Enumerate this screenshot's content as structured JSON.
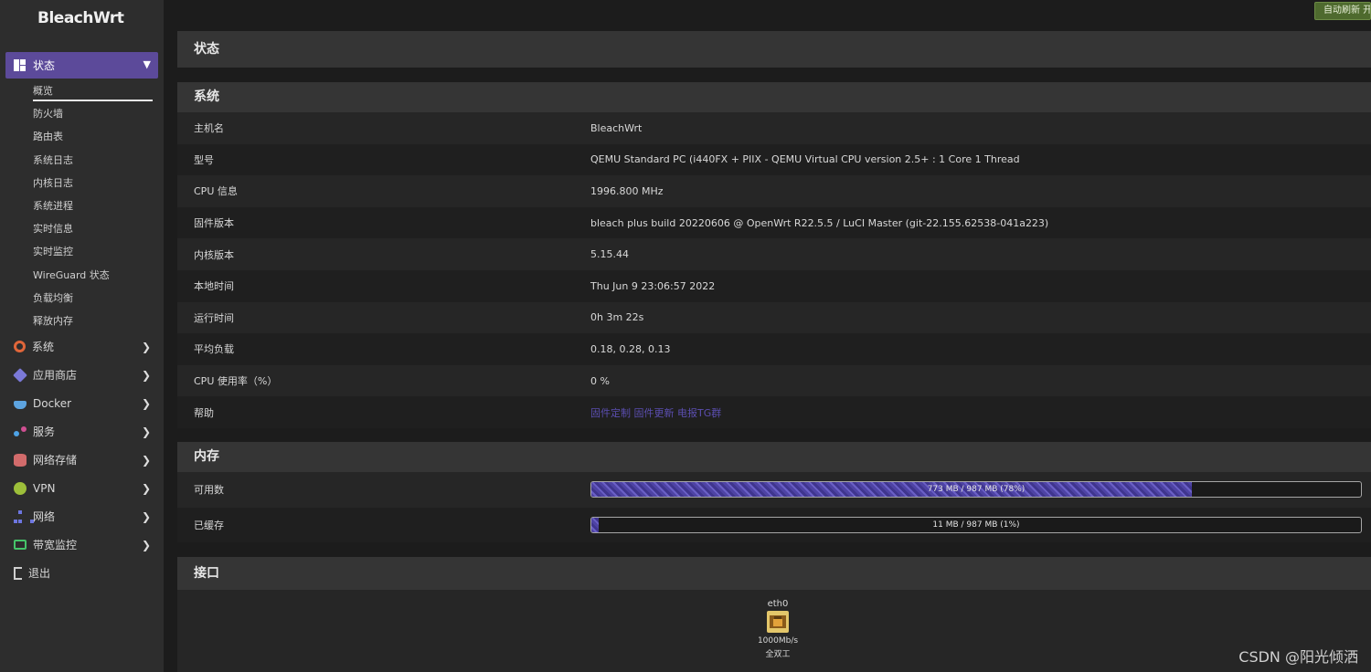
{
  "brand": "BleachWrt",
  "auto_refresh_label": "自动刷新 开",
  "sidebar": {
    "active_menu": "状态",
    "submenu": [
      "概览",
      "防火墙",
      "路由表",
      "系统日志",
      "内核日志",
      "系统进程",
      "实时信息",
      "实时监控",
      "WireGuard 状态",
      "负载均衡",
      "释放内存"
    ],
    "menu": [
      {
        "label": "系统",
        "icon": "gear-icon",
        "has_arrow": true
      },
      {
        "label": "应用商店",
        "icon": "cube-icon",
        "has_arrow": true
      },
      {
        "label": "Docker",
        "icon": "docker-icon",
        "has_arrow": true
      },
      {
        "label": "服务",
        "icon": "services-icon",
        "has_arrow": true
      },
      {
        "label": "网络存储",
        "icon": "database-icon",
        "has_arrow": true
      },
      {
        "label": "VPN",
        "icon": "globe-icon",
        "has_arrow": true
      },
      {
        "label": "网络",
        "icon": "network-tree-icon",
        "has_arrow": true
      },
      {
        "label": "带宽监控",
        "icon": "monitor-icon",
        "has_arrow": true
      },
      {
        "label": "退出",
        "icon": "logout-icon",
        "has_arrow": false
      }
    ]
  },
  "page_title": "状态",
  "system": {
    "title": "系统",
    "rows": [
      {
        "key": "主机名",
        "value": "BleachWrt"
      },
      {
        "key": "型号",
        "value": "QEMU Standard PC (i440FX + PIIX - QEMU Virtual CPU version 2.5+ : 1 Core 1 Thread"
      },
      {
        "key": "CPU 信息",
        "value": "1996.800 MHz"
      },
      {
        "key": "固件版本",
        "value": "bleach plus build 20220606 @ OpenWrt R22.5.5 / LuCI Master (git-22.155.62538-041a223)"
      },
      {
        "key": "内核版本",
        "value": "5.15.44"
      },
      {
        "key": "本地时间",
        "value": "Thu Jun 9 23:06:57 2022"
      },
      {
        "key": "运行时间",
        "value": "0h 3m 22s"
      },
      {
        "key": "平均负载",
        "value": "0.18, 0.28, 0.13"
      },
      {
        "key": "CPU 使用率（%）",
        "value": "0 %"
      },
      {
        "key": "帮助",
        "value": "固件定制 固件更新 电报TG群"
      }
    ]
  },
  "memory": {
    "title": "内存",
    "rows": [
      {
        "key": "可用数",
        "text": "773 MB / 987 MB (78%)",
        "fraction": 0.78
      },
      {
        "key": "已缓存",
        "text": "11 MB / 987 MB (1%)",
        "fraction": 0.01
      }
    ]
  },
  "interfaces": {
    "title": "接口",
    "ports": [
      {
        "name": "eth0",
        "speed": "1000Mb/s",
        "duplex": "全双工"
      }
    ]
  },
  "watermark": "CSDN @阳光倾洒",
  "colors": {
    "accent": "#5c4a9a",
    "bar": "#4e43a4"
  }
}
